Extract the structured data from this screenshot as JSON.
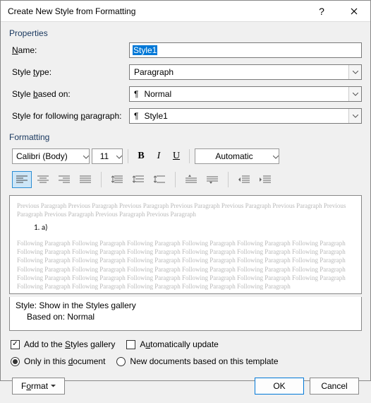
{
  "titlebar": {
    "title": "Create New Style from Formatting"
  },
  "sections": {
    "properties": "Properties",
    "formatting": "Formatting"
  },
  "labels": {
    "name_pre": "",
    "name_u": "N",
    "name_post": "ame:",
    "type_pre": "Style ",
    "type_u": "t",
    "type_post": "ype:",
    "based_pre": "Style ",
    "based_u": "b",
    "based_post": "ased on:",
    "follow_pre": "Style for following ",
    "follow_u": "p",
    "follow_post": "aragraph:"
  },
  "fields": {
    "name": "Style1",
    "type": "Paragraph",
    "based_on": "Normal",
    "following": "Style1"
  },
  "format": {
    "font": "Calibri (Body)",
    "size": "11",
    "color": "Automatic"
  },
  "preview": {
    "prev_para": "Previous Paragraph Previous Paragraph Previous Paragraph Previous Paragraph Previous Paragraph Previous Paragraph Previous Paragraph Previous Paragraph Previous Paragraph Previous Paragraph",
    "sample": "1.            a)",
    "follow_para": "Following Paragraph Following Paragraph Following Paragraph Following Paragraph Following Paragraph Following Paragraph Following Paragraph Following Paragraph Following Paragraph Following Paragraph Following Paragraph Following Paragraph Following Paragraph Following Paragraph Following Paragraph Following Paragraph Following Paragraph Following Paragraph Following Paragraph Following Paragraph Following Paragraph Following Paragraph Following Paragraph Following Paragraph Following Paragraph Following Paragraph Following Paragraph Following Paragraph Following Paragraph Following Paragraph Following Paragraph Following Paragraph Following Paragraph Following Paragraph Following Paragraph"
  },
  "desc": {
    "line1": "Style: Show in the Styles gallery",
    "line2": "Based on: Normal"
  },
  "options": {
    "add_pre": "Add to the ",
    "add_u": "S",
    "add_post": "tyles gallery",
    "auto_pre": "A",
    "auto_u": "u",
    "auto_post": "tomatically update",
    "only_pre": "Only in this ",
    "only_u": "d",
    "only_post": "ocument",
    "newdoc": "New documents based on this template",
    "add_checked": true,
    "auto_checked": false,
    "only_selected": true
  },
  "buttons": {
    "format_pre": "F",
    "format_u": "o",
    "format_post": "rmat",
    "ok": "OK",
    "cancel": "Cancel"
  }
}
